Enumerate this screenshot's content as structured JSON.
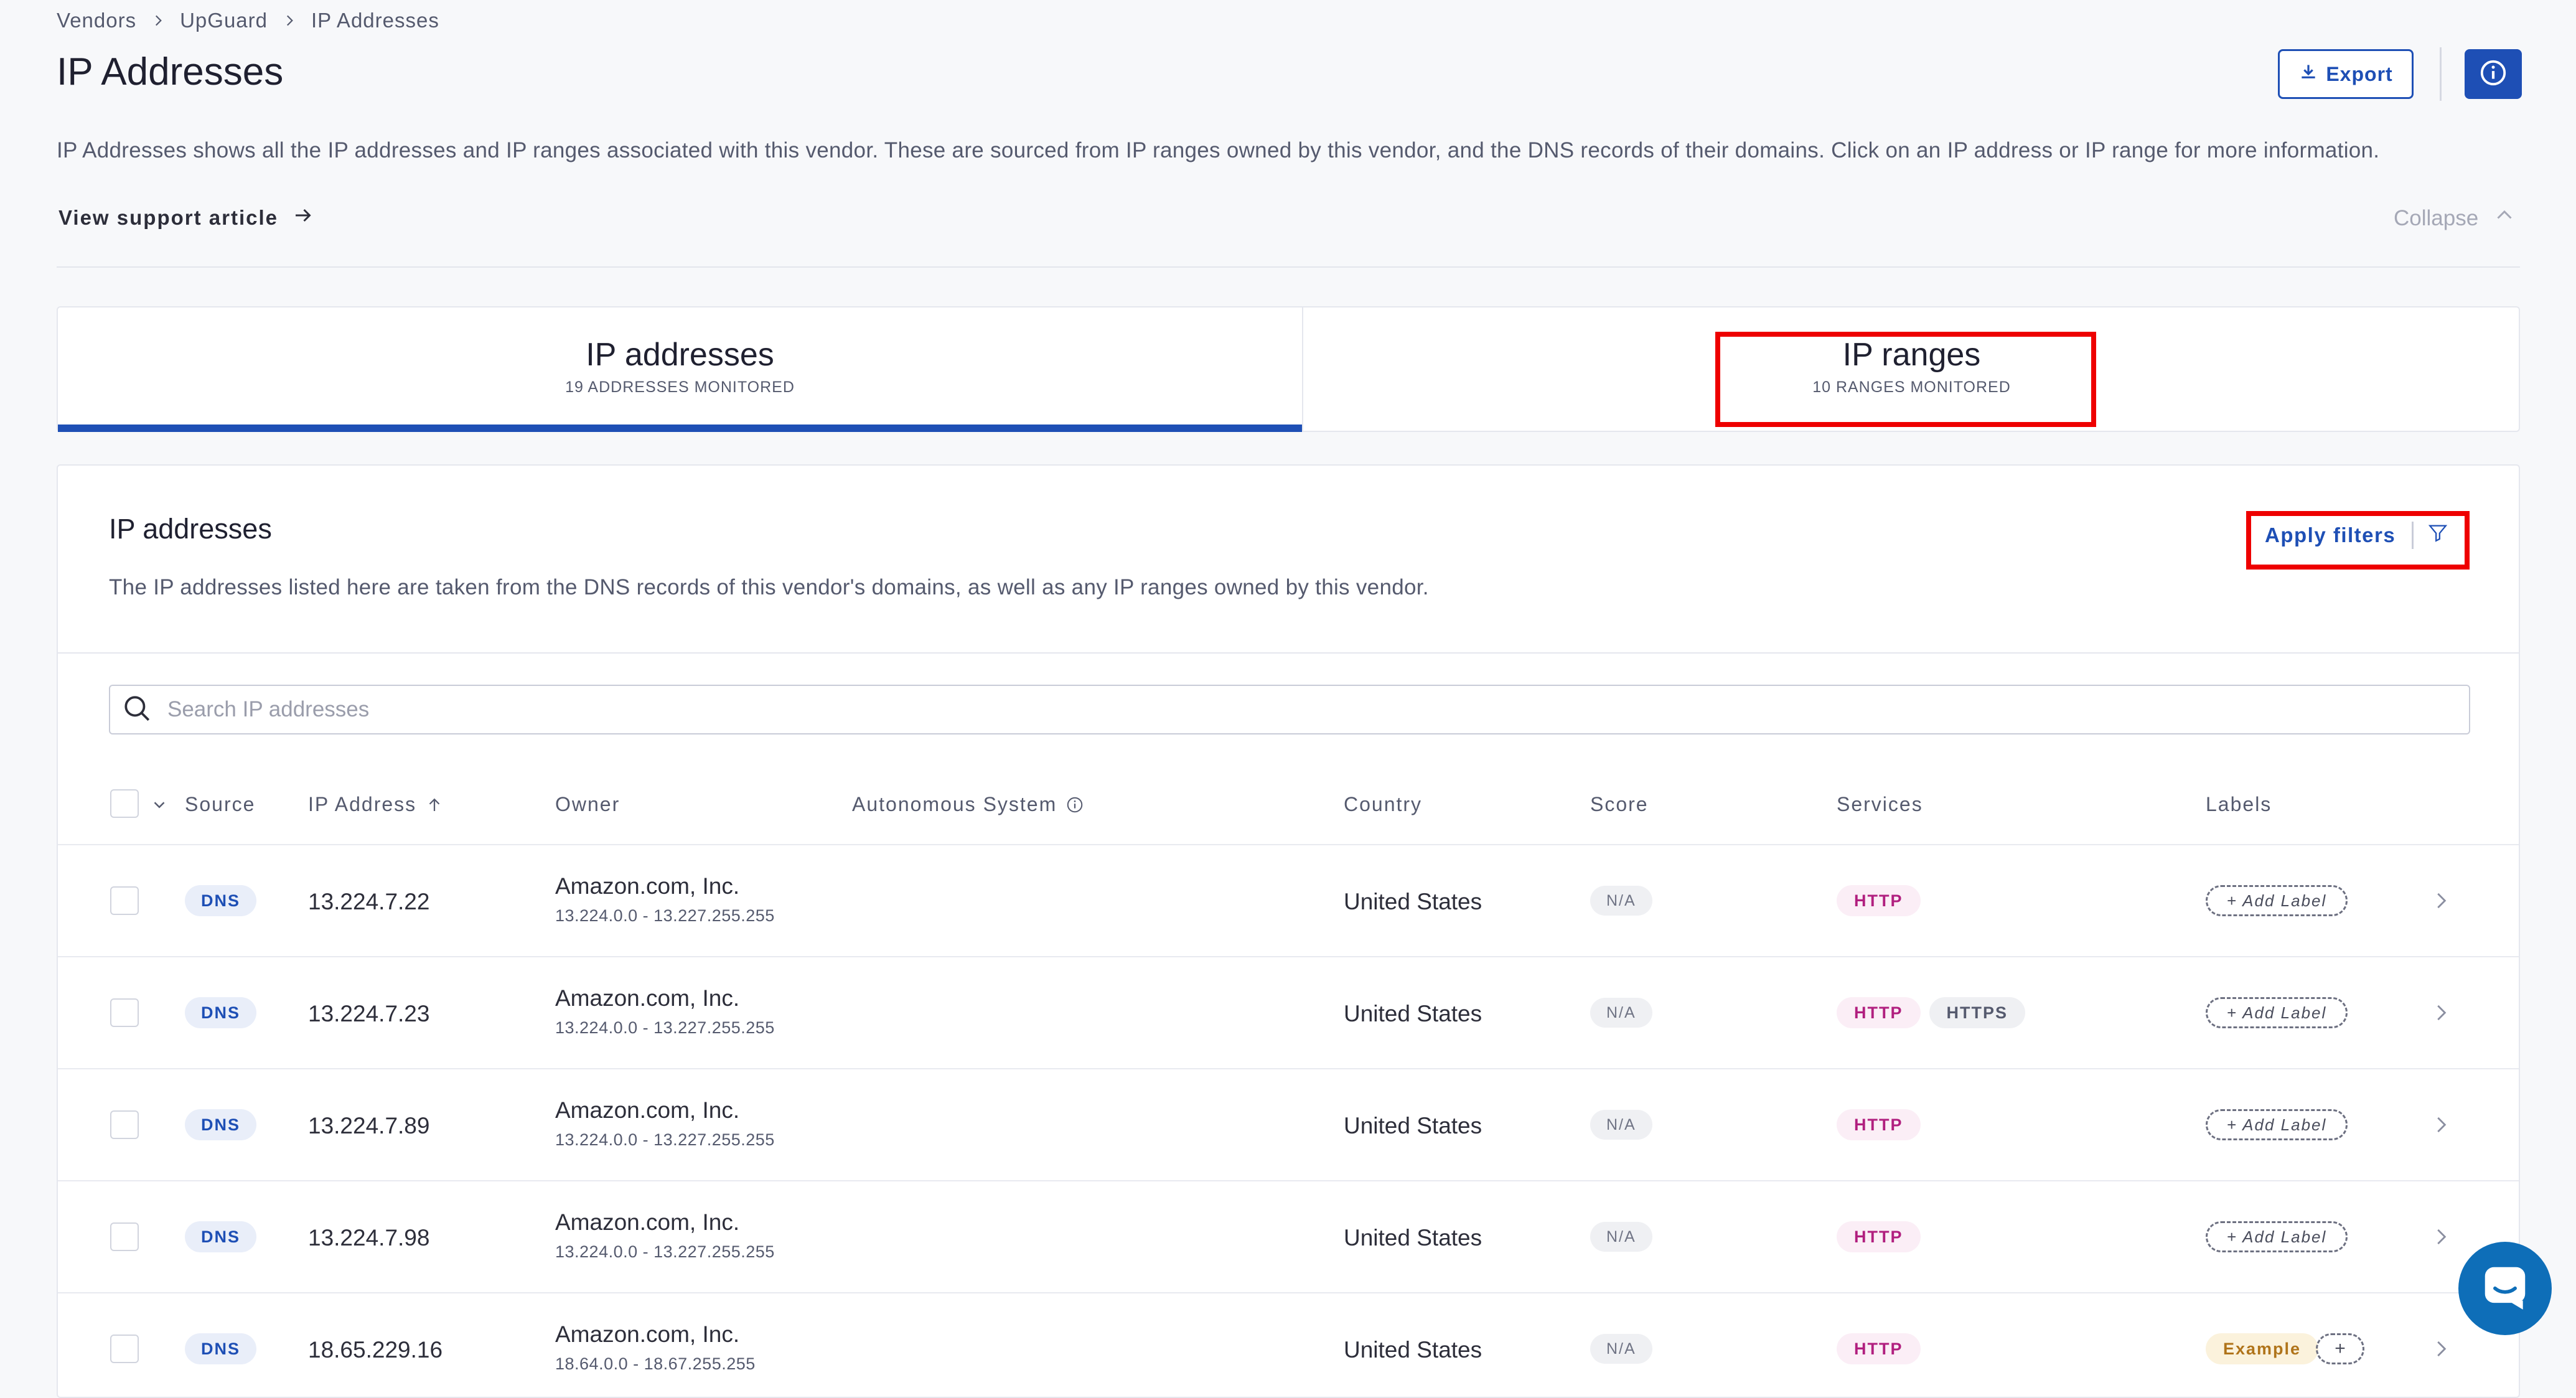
{
  "breadcrumb": [
    "Vendors",
    "UpGuard",
    "IP Addresses"
  ],
  "page_title": "IP Addresses",
  "header": {
    "export_label": "Export"
  },
  "description": "IP Addresses shows all the IP addresses and IP ranges associated with this vendor. These are sourced from IP ranges owned by this vendor, and the DNS records of their domains. Click on an IP address or IP range for more information.",
  "support_link": "View support article",
  "collapse_label": "Collapse",
  "tabs": [
    {
      "label": "IP addresses",
      "sub": "19 ADDRESSES MONITORED",
      "active": true
    },
    {
      "label": "IP ranges",
      "sub": "10 RANGES MONITORED",
      "active": false
    }
  ],
  "card": {
    "title": "IP addresses",
    "description": "The IP addresses listed here are taken from the DNS records of this vendor's domains, as well as any IP ranges owned by this vendor.",
    "filters_label": "Apply filters",
    "search_placeholder": "Search IP addresses"
  },
  "table": {
    "columns": [
      "Source",
      "IP Address",
      "Owner",
      "Autonomous System",
      "Country",
      "Score",
      "Services",
      "Labels"
    ],
    "rows": [
      {
        "source": "DNS",
        "ip": "13.224.7.22",
        "owner": "Amazon.com, Inc.",
        "range": "13.224.0.0 - 13.227.255.255",
        "country": "United States",
        "score": "N/A",
        "services": [
          "HTTP"
        ],
        "labels": [
          "+ Add Label"
        ]
      },
      {
        "source": "DNS",
        "ip": "13.224.7.23",
        "owner": "Amazon.com, Inc.",
        "range": "13.224.0.0 - 13.227.255.255",
        "country": "United States",
        "score": "N/A",
        "services": [
          "HTTP",
          "HTTPS"
        ],
        "labels": [
          "+ Add Label"
        ]
      },
      {
        "source": "DNS",
        "ip": "13.224.7.89",
        "owner": "Amazon.com, Inc.",
        "range": "13.224.0.0 - 13.227.255.255",
        "country": "United States",
        "score": "N/A",
        "services": [
          "HTTP"
        ],
        "labels": [
          "+ Add Label"
        ]
      },
      {
        "source": "DNS",
        "ip": "13.224.7.98",
        "owner": "Amazon.com, Inc.",
        "range": "13.224.0.0 - 13.227.255.255",
        "country": "United States",
        "score": "N/A",
        "services": [
          "HTTP"
        ],
        "labels": [
          "+ Add Label"
        ]
      },
      {
        "source": "DNS",
        "ip": "18.65.229.16",
        "owner": "Amazon.com, Inc.",
        "range": "18.64.0.0 - 18.67.255.255",
        "country": "United States",
        "score": "N/A",
        "services": [
          "HTTP"
        ],
        "labels": [
          "Example",
          "+"
        ]
      }
    ]
  },
  "colors": {
    "accent": "#1e4fb5",
    "highlight": "#ee0000",
    "http": "#b11f7f",
    "example": "#b0741a",
    "chat": "#0e6eb8"
  }
}
